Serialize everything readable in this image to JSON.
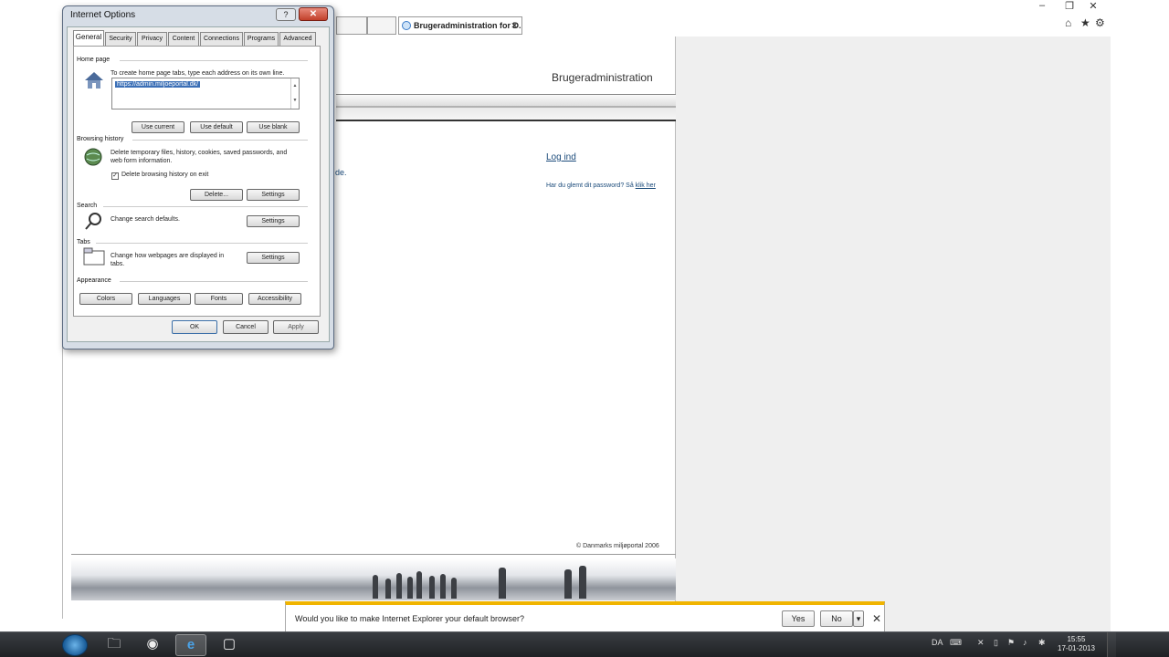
{
  "browser": {
    "window_controls": [
      "–",
      "❐",
      "✕"
    ],
    "tabs": [
      {
        "label": "",
        "active": false
      },
      {
        "label": "",
        "active": false
      },
      {
        "label": "Brugeradministration for D...",
        "active": true
      }
    ],
    "tab_close": "✕",
    "command_icons": {
      "home": "home-icon",
      "favorites": "star-icon",
      "tools": "gear-icon"
    }
  },
  "page": {
    "header_title": "Brugeradministration",
    "login_link": "Log ind",
    "forgot_text": "Har du glemt dit password? Så ",
    "forgot_link": "klik her",
    "partial_text": "de.",
    "copyright": "© Danmarks miljøportal 2006"
  },
  "infobar": {
    "message": "Would you like to make Internet Explorer your default browser?",
    "yes": "Yes",
    "no": "No",
    "dropdown": "▾",
    "close": "✕",
    "accent": "#f0b400"
  },
  "dialog": {
    "title": "Internet Options",
    "help": "?",
    "close": "✕",
    "tabs": [
      "General",
      "Security",
      "Privacy",
      "Content",
      "Connections",
      "Programs",
      "Advanced"
    ],
    "home_page": {
      "heading": "Home page",
      "description": "To create home page tabs, type each address on its own line.",
      "url": "https://admin.miljoeportal.dk/",
      "buttons": [
        "Use current",
        "Use default",
        "Use blank"
      ]
    },
    "browsing_history": {
      "heading": "Browsing history",
      "description": "Delete temporary files, history, cookies, saved passwords, and web form information.",
      "checkbox_label": "Delete browsing history on exit",
      "checkbox_checked": true,
      "buttons": [
        "Delete...",
        "Settings"
      ]
    },
    "search": {
      "heading": "Search",
      "description": "Change search defaults.",
      "button": "Settings"
    },
    "tabs_section": {
      "heading": "Tabs",
      "description": "Change how webpages are displayed in tabs.",
      "button": "Settings"
    },
    "appearance": {
      "heading": "Appearance",
      "buttons": [
        "Colors",
        "Languages",
        "Fonts",
        "Accessibility"
      ]
    },
    "footer": {
      "ok": "OK",
      "cancel": "Cancel",
      "apply": "Apply"
    }
  },
  "taskbar": {
    "apps": [
      {
        "icon": "folder-icon",
        "glyph": "🗀"
      },
      {
        "icon": "chrome-icon",
        "glyph": "◉"
      },
      {
        "icon": "internet-explorer-icon",
        "glyph": "e"
      },
      {
        "icon": "window-icon",
        "glyph": "▢"
      }
    ],
    "language": "DA",
    "time": "15:55",
    "date": "17-01-2013"
  }
}
